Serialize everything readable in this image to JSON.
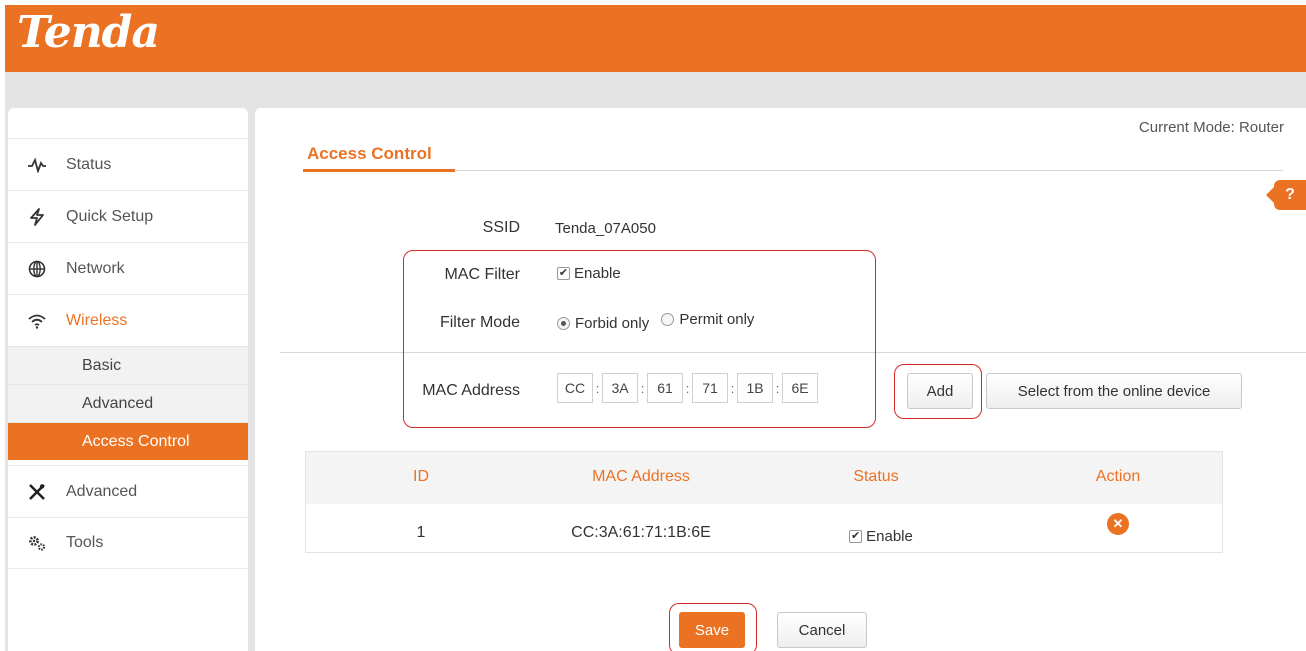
{
  "header": {
    "logo_text": "Tenda",
    "brand_color": "#ec7223"
  },
  "sidebar": {
    "items": [
      {
        "label": "Status",
        "icon": "pulse-icon"
      },
      {
        "label": "Quick Setup",
        "icon": "lightning-icon"
      },
      {
        "label": "Network",
        "icon": "globe-icon"
      },
      {
        "label": "Wireless",
        "icon": "wifi-icon"
      },
      {
        "label": "Advanced",
        "icon": "tools-icon"
      },
      {
        "label": "Tools",
        "icon": "gears-icon"
      }
    ],
    "wireless_sub": [
      "Basic",
      "Advanced",
      "Access Control"
    ]
  },
  "content": {
    "current_mode": "Current Mode: Router",
    "title": "Access Control",
    "help": "?",
    "ssid_label": "SSID",
    "ssid_value": "Tenda_07A050",
    "mac_filter_label": "MAC Filter",
    "mac_filter_option": "Enable",
    "mac_filter_enabled": true,
    "filter_mode_label": "Filter Mode",
    "filter_mode_options": [
      "Forbid only",
      "Permit only"
    ],
    "filter_mode_selected": "Forbid only",
    "mac_address_label": "MAC Address",
    "mac_octets": [
      "CC",
      "3A",
      "61",
      "71",
      "1B",
      "6E"
    ],
    "add_label": "Add",
    "select_online_label": "Select from the online device",
    "table": {
      "headers": [
        "ID",
        "MAC Address",
        "Status",
        "Action"
      ],
      "rows": [
        {
          "id": "1",
          "mac": "CC:3A:61:71:1B:6E",
          "status": "Enable",
          "action": "delete"
        }
      ]
    },
    "save_label": "Save",
    "cancel_label": "Cancel"
  }
}
